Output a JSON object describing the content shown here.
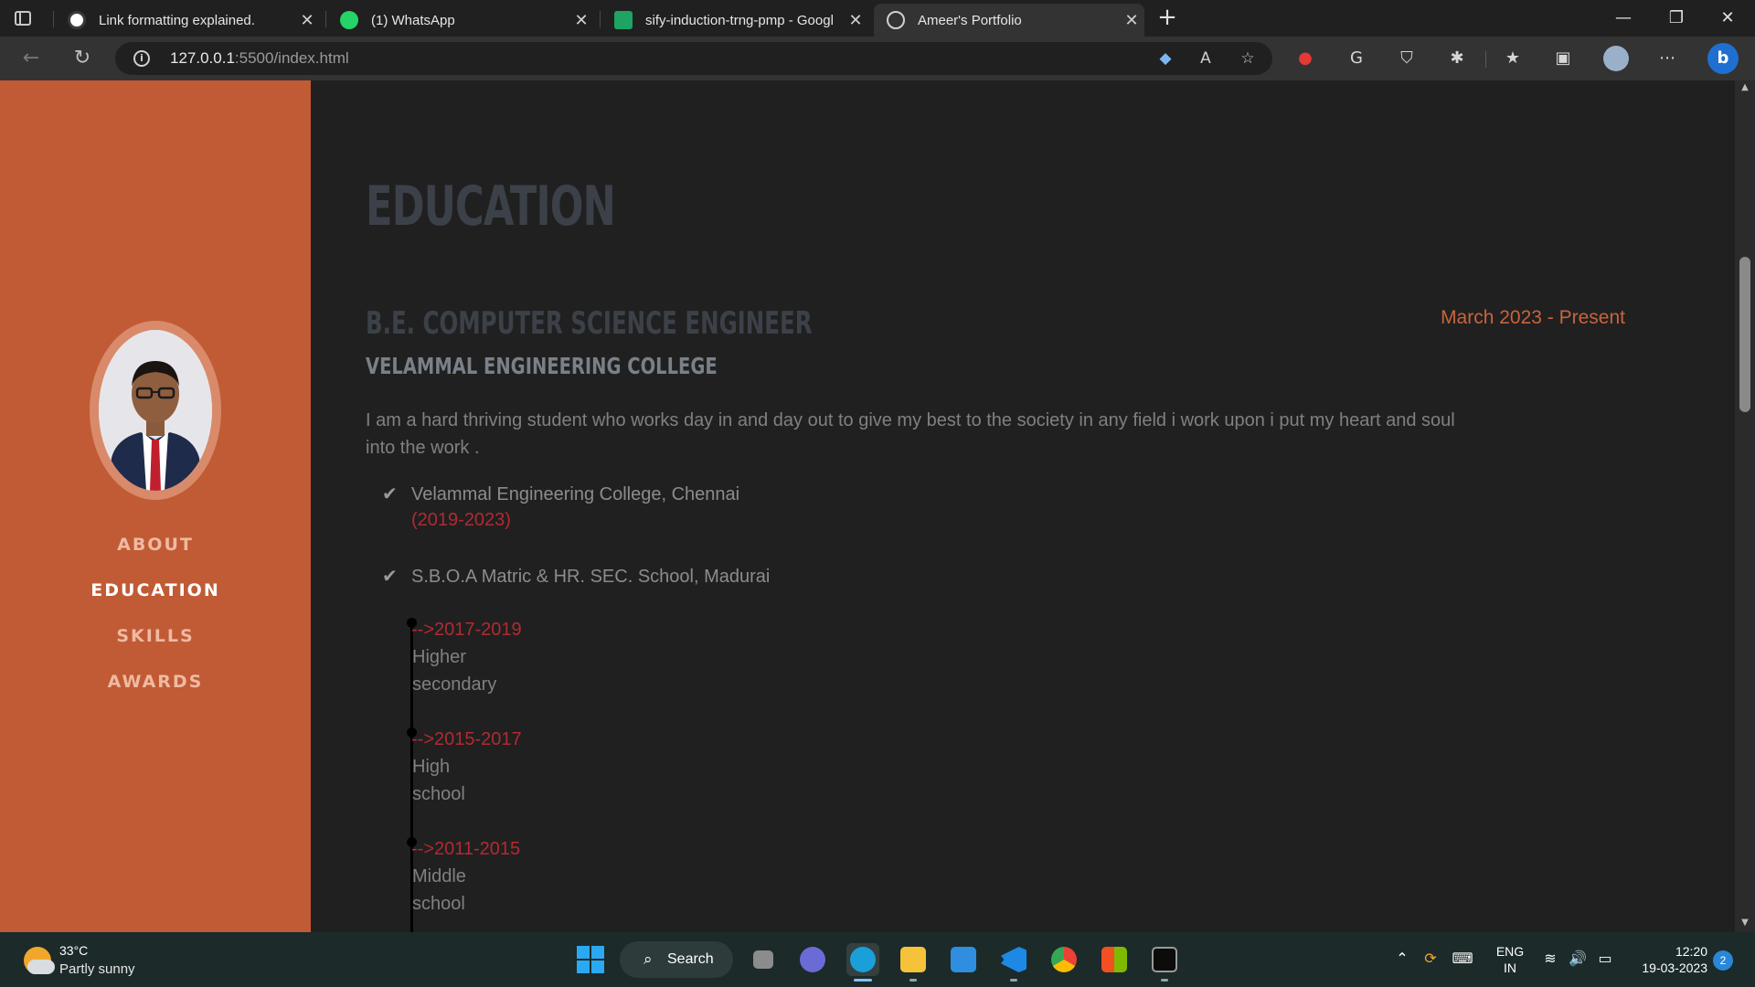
{
  "browser": {
    "tabs": [
      {
        "title": "Link formatting explained.",
        "icon": "chatgpt-icon"
      },
      {
        "title": "(1) WhatsApp",
        "icon": "whatsapp-icon"
      },
      {
        "title": "sify-induction-trng-pmp - Googl",
        "icon": "google-sheets-icon"
      },
      {
        "title": "Ameer's Portfolio",
        "icon": "globe-icon",
        "active": true
      }
    ],
    "url_host": "127.0.0.1",
    "url_rest": ":5500/index.html"
  },
  "sidebar": {
    "nav": [
      {
        "label": "ABOUT"
      },
      {
        "label": "EDUCATION",
        "active": true
      },
      {
        "label": "SKILLS"
      },
      {
        "label": "AWARDS"
      }
    ]
  },
  "education": {
    "heading": "EDUCATION",
    "degree": "B.E. COMPUTER SCIENCE ENGINEER",
    "college": "VELAMMAL ENGINEERING COLLEGE",
    "date_range": "March 2023 - Present",
    "description": "I am a hard thriving student who works day in and day out to give my best to the society in any field i work upon i put my heart and soul into the work .",
    "items": [
      {
        "text": "Velammal Engineering College, Chennai",
        "years": "(2019-2023)"
      },
      {
        "text": "S.B.O.A Matric & HR. SEC. School, Madurai"
      }
    ],
    "timeline": [
      {
        "years": "-->2017-2019",
        "line1": "Higher",
        "line2": "secondary"
      },
      {
        "years": "-->2015-2017",
        "line1": "High",
        "line2": "school"
      },
      {
        "years": "-->2011-2015",
        "line1": "Middle",
        "line2": "school"
      }
    ]
  },
  "taskbar": {
    "weather_temp": "33°C",
    "weather_desc": "Partly sunny",
    "search_label": "Search",
    "lang_line1": "ENG",
    "lang_line2": "IN",
    "time": "12:20",
    "date": "19-03-2023",
    "notifications": "2"
  },
  "colors": {
    "sidebar_bg": "#c05b35",
    "accent_red": "#b22a32",
    "date_orange": "#c8643d",
    "page_bg": "#202020"
  }
}
